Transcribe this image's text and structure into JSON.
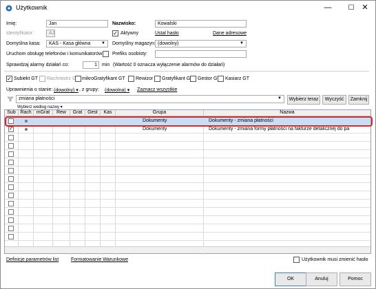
{
  "window": {
    "title": "Użytkownik",
    "minimize": "—",
    "maximize": "☐",
    "close": "✕"
  },
  "form": {
    "imie_label": "Imię:",
    "imie_value": "Jan",
    "nazwisko_label": "Nazwisko:",
    "nazwisko_value": "Kowalski",
    "identyfikator_label": "Identyfikator:",
    "identyfikator_value": "AJ",
    "aktywny_label": "Aktywny",
    "aktywny_checked": true,
    "ustal_haslo": "Ustal hasło",
    "dane_adresowe": "Dane adresowe",
    "kasa_label": "Domyślna kasa:",
    "kasa_value": "KAS - Kasa główna",
    "magazyn_label": "Domyślny magazyn:",
    "magazyn_value": "(dowolny)",
    "uruchom_label": "Uruchom obsługę telefonów i komunikatorów",
    "prefiks_label": "Prefiks osobisty:",
    "prefiks_value": "",
    "alarm_label": "Sprawdzaj alarmy działań co:",
    "alarm_value": "1",
    "alarm_unit": "min",
    "alarm_note": "(Wartość 0 oznacza wyłączenie alarmów do działań)"
  },
  "modules": [
    {
      "label": "Subiekt GT",
      "checked": true,
      "disabled": false
    },
    {
      "label": "Rachmistrz GT",
      "checked": false,
      "disabled": true
    },
    {
      "label": "mikroGratyfikant GT",
      "checked": false,
      "disabled": false
    },
    {
      "label": "Rewizor GT",
      "checked": false,
      "disabled": false
    },
    {
      "label": "Gratyfikant GT",
      "checked": false,
      "disabled": false
    },
    {
      "label": "Gestor GT",
      "checked": false,
      "disabled": false
    },
    {
      "label": "Kasiarz GT",
      "checked": false,
      "disabled": false
    }
  ],
  "permissions": {
    "label": "Uprawnienia o stanie:",
    "state_value": "(dowolny)",
    "group_label": ", z grupy:",
    "group_value": "(dowolna)",
    "select_all": "Zaznacz wszystkie"
  },
  "search": {
    "value": "zmiana płatności",
    "select_button": "Wybierz teraz",
    "clear_button": "Wyczyść",
    "close_button": "Zamknij",
    "choose_by": "Wybierz według nazwy"
  },
  "table": {
    "columns": [
      "Sub",
      "Rach",
      "mGrat",
      "Rew",
      "Grat",
      "Gest",
      "Kas",
      "Grupa",
      "Nazwa"
    ],
    "rows": [
      {
        "checked": false,
        "grupa": "Dokumenty",
        "nazwa": "Dokumenty - zmiana płatności",
        "selected": true
      },
      {
        "checked": true,
        "grupa": "Dokumenty",
        "nazwa": "Dokumenty - zmiana formy płatności na fakturze detalicznej do pa",
        "selected": false
      }
    ]
  },
  "footer": {
    "definicje": "Definicje parametrów list",
    "formatowanie": "Formatowanie Warunkowe",
    "must_change_label": "Użytkownik musi zmienić hasło",
    "ok": "OK",
    "cancel": "Anuluj",
    "help": "Pomoc"
  }
}
